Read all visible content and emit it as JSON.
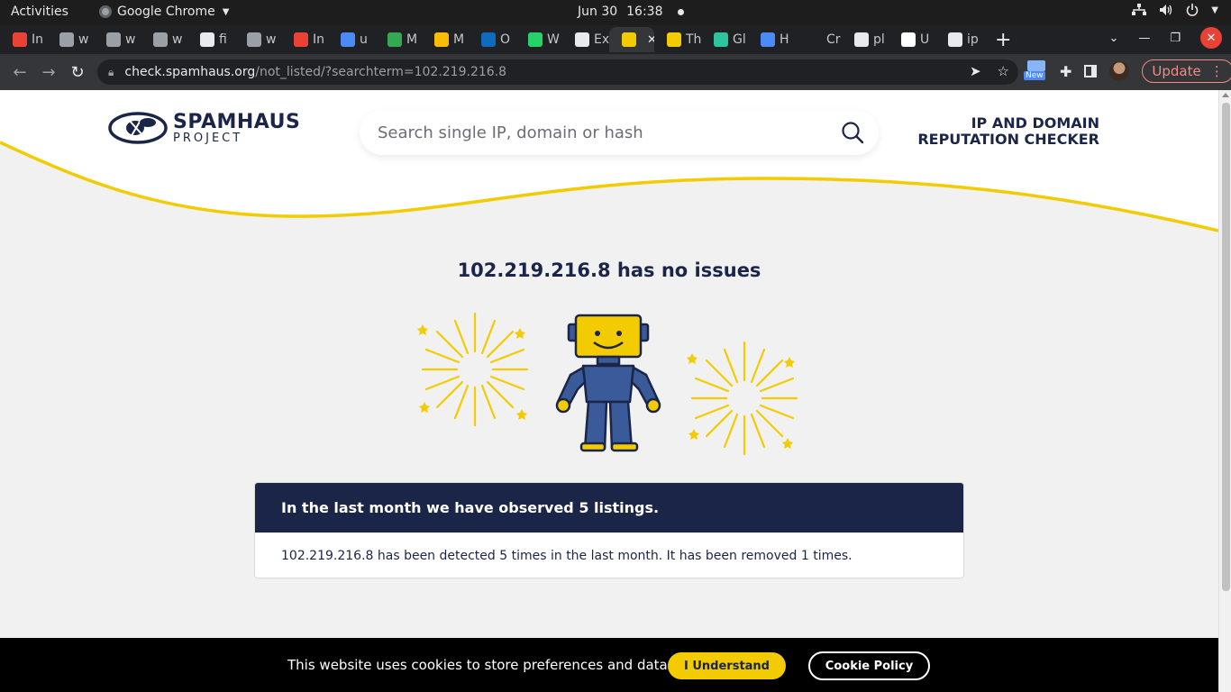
{
  "os": {
    "activities": "Activities",
    "app_name": "Google Chrome",
    "date": "Jun 30",
    "time": "16:38"
  },
  "tabs": [
    {
      "title": "In",
      "favicon": "gmail-icon",
      "color": "#ea4335"
    },
    {
      "title": "w",
      "favicon": "cpanel-icon",
      "color": "#9aa0a6"
    },
    {
      "title": "w",
      "favicon": "cpanel-icon",
      "color": "#9aa0a6"
    },
    {
      "title": "w",
      "favicon": "cpanel-icon",
      "color": "#9aa0a6"
    },
    {
      "title": "fi",
      "favicon": "document-icon",
      "color": "#e8eaed"
    },
    {
      "title": "w",
      "favicon": "cpanel-icon",
      "color": "#9aa0a6"
    },
    {
      "title": "In",
      "favicon": "gmail-icon",
      "color": "#ea4335"
    },
    {
      "title": "u",
      "favicon": "blue-circle-icon",
      "color": "#4c8bf5"
    },
    {
      "title": "M",
      "favicon": "drive-icon",
      "color": "#34a853"
    },
    {
      "title": "M",
      "favicon": "drive-icon",
      "color": "#fbbc04"
    },
    {
      "title": "O",
      "favicon": "outlook-icon",
      "color": "#0f6cbd"
    },
    {
      "title": "W",
      "favicon": "whatsapp-icon",
      "color": "#25d366"
    },
    {
      "title": "Ex",
      "favicon": "globe-icon",
      "color": "#e8eaed"
    },
    {
      "title": "",
      "favicon": "spamhaus-icon",
      "color": "#f2cb00"
    },
    {
      "title": "Th",
      "favicon": "s-icon",
      "color": "#f2cb00"
    },
    {
      "title": "Gl",
      "favicon": "green-drop-icon",
      "color": "#2ec4a0"
    },
    {
      "title": "H",
      "favicon": "blue-box-icon",
      "color": "#4c8bf5"
    },
    {
      "title": "Cr",
      "favicon": "github-icon",
      "color": "#202124"
    },
    {
      "title": "pl",
      "favicon": "document-icon",
      "color": "#e8eaed"
    },
    {
      "title": "U",
      "favicon": "plesk-icon",
      "color": "#ffffff"
    },
    {
      "title": "ip",
      "favicon": "document-icon",
      "color": "#e8eaed"
    }
  ],
  "address": {
    "host": "check.spamhaus.org",
    "path": "/not_listed/?searchterm=102.219.216.8"
  },
  "toolbar": {
    "new_badge": "New",
    "update_label": "Update"
  },
  "site": {
    "logo_line1": "SPAMHAUS",
    "logo_line2": "PROJECT",
    "search_placeholder": "Search single IP, domain or hash",
    "tagline_line1": "IP AND DOMAIN",
    "tagline_line2": "REPUTATION CHECKER",
    "result_title": "102.219.216.8 has no issues",
    "card_heading": "In the last month we have observed 5 listings.",
    "card_body": "102.219.216.8 has been detected 5 times in the last month. It has been removed 1 times."
  },
  "cookie": {
    "message": "This website uses cookies to store preferences and data.",
    "accept_label": "I Understand",
    "policy_label": "Cookie Policy"
  },
  "colors": {
    "brand_navy": "#1b2547",
    "brand_yellow": "#f2cb00",
    "page_bg": "#f1f1f1"
  }
}
